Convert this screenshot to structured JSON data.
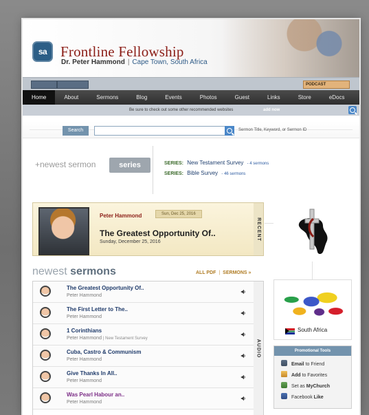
{
  "header": {
    "logo_text": "sa",
    "title": "Frontline Fellowship",
    "subtitle_name": "Dr. Peter Hammond",
    "subtitle_sep": "|",
    "subtitle_location": "Cape Town, South Africa"
  },
  "strip": {
    "left_1": "",
    "left_2": "",
    "rss": "PODCAST"
  },
  "nav": {
    "items": [
      "Home",
      "About",
      "Sermons",
      "Blog",
      "Events",
      "Photos",
      "Guest",
      "Links",
      "Store",
      "eDocs"
    ]
  },
  "notice": {
    "text": "Be sure to check out some other recommended websites",
    "link": "add now"
  },
  "search": {
    "button_label": "Search",
    "placeholder": "",
    "hint": "Sermon Title, Keyword, or Sermon ID"
  },
  "series": {
    "newest_sermon_label": "+newest sermon",
    "tab_label": "series",
    "items": [
      {
        "prefix": "SERIES:",
        "title": "New Testament Survey",
        "count": "- 4 sermons"
      },
      {
        "prefix": "SERIES:",
        "title": "Bible Survey",
        "count": "- 46 sermons"
      }
    ]
  },
  "recent": {
    "author": "Peter Hammond",
    "date": "Sun, Dec 25, 2016",
    "title": "The Greatest Opportunity Of..",
    "subtitle": "Sunday, December 25, 2016",
    "tag": "RECENT"
  },
  "newest_sermons": {
    "title_light": "newest",
    "title_strong": "sermons",
    "links": {
      "pdf": "ALL PDF",
      "sep": "|",
      "sermons": "SERMONS »"
    },
    "audio_tag": "AUDIO",
    "rows": [
      {
        "title": "The Greatest Opportunity Of..",
        "speaker": "Peter Hammond",
        "extra": "",
        "title_color": "blue"
      },
      {
        "title": "The First Letter to The..",
        "speaker": "Peter Hammond",
        "extra": "",
        "title_color": "blue"
      },
      {
        "title": "1 Corinthians",
        "speaker": "Peter Hammond",
        "extra": "| New Testament Survey",
        "title_color": "blue"
      },
      {
        "title": "Cuba, Castro & Communism",
        "speaker": "Peter Hammond",
        "extra": "",
        "title_color": "blue"
      },
      {
        "title": "Give Thanks In All..",
        "speaker": "Peter Hammond",
        "extra": "",
        "title_color": "blue"
      },
      {
        "title": "Was Pearl Habour an..",
        "speaker": "Peter Hammond",
        "extra": "",
        "title_color": "purple"
      }
    ]
  },
  "sidebar": {
    "map_label": "South Africa",
    "promo_title": "Promotional Tools",
    "promo_items": [
      {
        "icon": "mail-icon",
        "bold": "Email",
        "rest": " to Friend"
      },
      {
        "icon": "star-icon",
        "bold": "Add",
        "rest": " to Favorites"
      },
      {
        "icon": "home-icon",
        "bold": "MyChurch",
        "prefix": "Set as "
      },
      {
        "icon": "like-icon",
        "bold": "Like",
        "prefix": "Facebook "
      }
    ]
  },
  "colors": {
    "brand_red": "#8b1d16",
    "nav_bg": "#2f2f2f",
    "link_blue": "#1e3a6a",
    "accent_blue": "#4a87c8"
  }
}
